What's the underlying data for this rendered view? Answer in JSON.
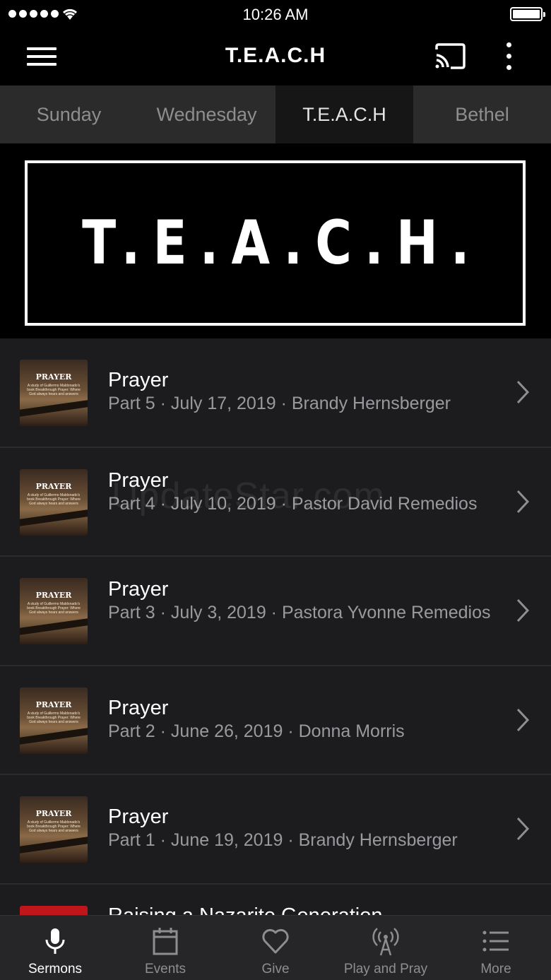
{
  "status_bar": {
    "time": "10:26 AM",
    "signal_bars": 5,
    "battery_level": 1.0
  },
  "nav": {
    "title": "T.E.A.C.H",
    "menu_icon": "hamburger-icon",
    "cast_icon": "cast-icon",
    "more_icon": "kebab-icon"
  },
  "tabs": [
    {
      "label": "Sunday",
      "active": false
    },
    {
      "label": "Wednesday",
      "active": false
    },
    {
      "label": "T.E.A.C.H",
      "active": true
    },
    {
      "label": "Bethel",
      "active": false
    }
  ],
  "banner": {
    "text": "T.E.A.C.H."
  },
  "thumb": {
    "title": "PRAYER",
    "subtitle": "A study of Guillermo Maldonado's book Breakthrough Prayer: Where God always hears and answers"
  },
  "sermons": [
    {
      "title": "Prayer",
      "meta": "Part 5 · July 17, 2019 · Brandy Hernsberger"
    },
    {
      "title": "Prayer",
      "meta": "Part 4 · July 10, 2019 · Pastor David Remedios"
    },
    {
      "title": "Prayer",
      "meta": "Part 3 · July 3, 2019 · Pastora Yvonne Remedios"
    },
    {
      "title": "Prayer",
      "meta": "Part 2 · June 26, 2019 · Donna Morris"
    },
    {
      "title": "Prayer",
      "meta": "Part 1 · June 19, 2019 · Brandy Hernsberger"
    },
    {
      "title": "Raising a Nazarite Generation",
      "meta": ""
    }
  ],
  "watermark": "UpdateStar.com",
  "tabbar": [
    {
      "label": "Sermons",
      "icon": "microphone-icon",
      "active": true
    },
    {
      "label": "Events",
      "icon": "calendar-icon",
      "active": false
    },
    {
      "label": "Give",
      "icon": "heart-icon",
      "active": false
    },
    {
      "label": "Play and Pray",
      "icon": "broadcast-icon",
      "active": false
    },
    {
      "label": "More",
      "icon": "list-icon",
      "active": false
    }
  ],
  "colors": {
    "background": "#000000",
    "list_bg": "#1c1c1e",
    "tabs_bg": "#2b2b2b",
    "active_tab_bg": "#161616",
    "meta_text": "#9a9a9e",
    "tabbar_bg": "#262628"
  }
}
